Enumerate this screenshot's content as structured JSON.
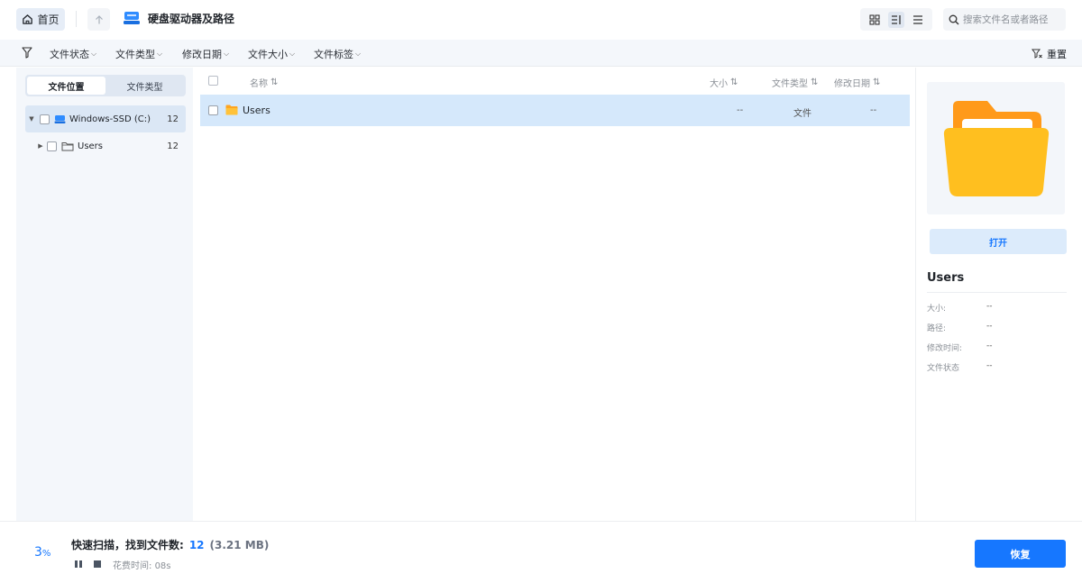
{
  "topbar": {
    "home_label": "首页",
    "drive_title": "硬盘驱动器及路径",
    "search_placeholder": "搜索文件名或者路径"
  },
  "filters": {
    "items": [
      "文件状态",
      "文件类型",
      "修改日期",
      "文件大小",
      "文件标签"
    ],
    "reset_label": "重置"
  },
  "left_panel": {
    "tabs": [
      "文件位置",
      "文件类型"
    ],
    "active_tab": "文件位置",
    "tree": [
      {
        "label": "Windows-SSD (C:)",
        "count": "12"
      },
      {
        "label": "Users",
        "count": "12"
      }
    ]
  },
  "list": {
    "headers": {
      "name": "名称",
      "size": "大小",
      "type": "文件类型",
      "date": "修改日期"
    },
    "rows": [
      {
        "name": "Users",
        "size": "--",
        "type": "文件",
        "date": "--"
      }
    ]
  },
  "details": {
    "open_label": "打开",
    "name": "Users",
    "fields": [
      {
        "label": "大小:",
        "value": "--"
      },
      {
        "label": "路径:",
        "value": "--"
      },
      {
        "label": "修改时间:",
        "value": "--"
      },
      {
        "label": "文件状态",
        "value": "--"
      }
    ]
  },
  "status": {
    "progress_value": "3",
    "progress_unit": "%",
    "title": "快速扫描，找到文件数:",
    "found_count": "12",
    "found_size": "(3.21 MB)",
    "elapsed_label": "花费时间:",
    "elapsed_value": "08s",
    "recover_label": "恢复"
  },
  "colors": {
    "accent": "#1677ff",
    "folder": "#ffb020",
    "selected_row": "#d5e8fb"
  }
}
